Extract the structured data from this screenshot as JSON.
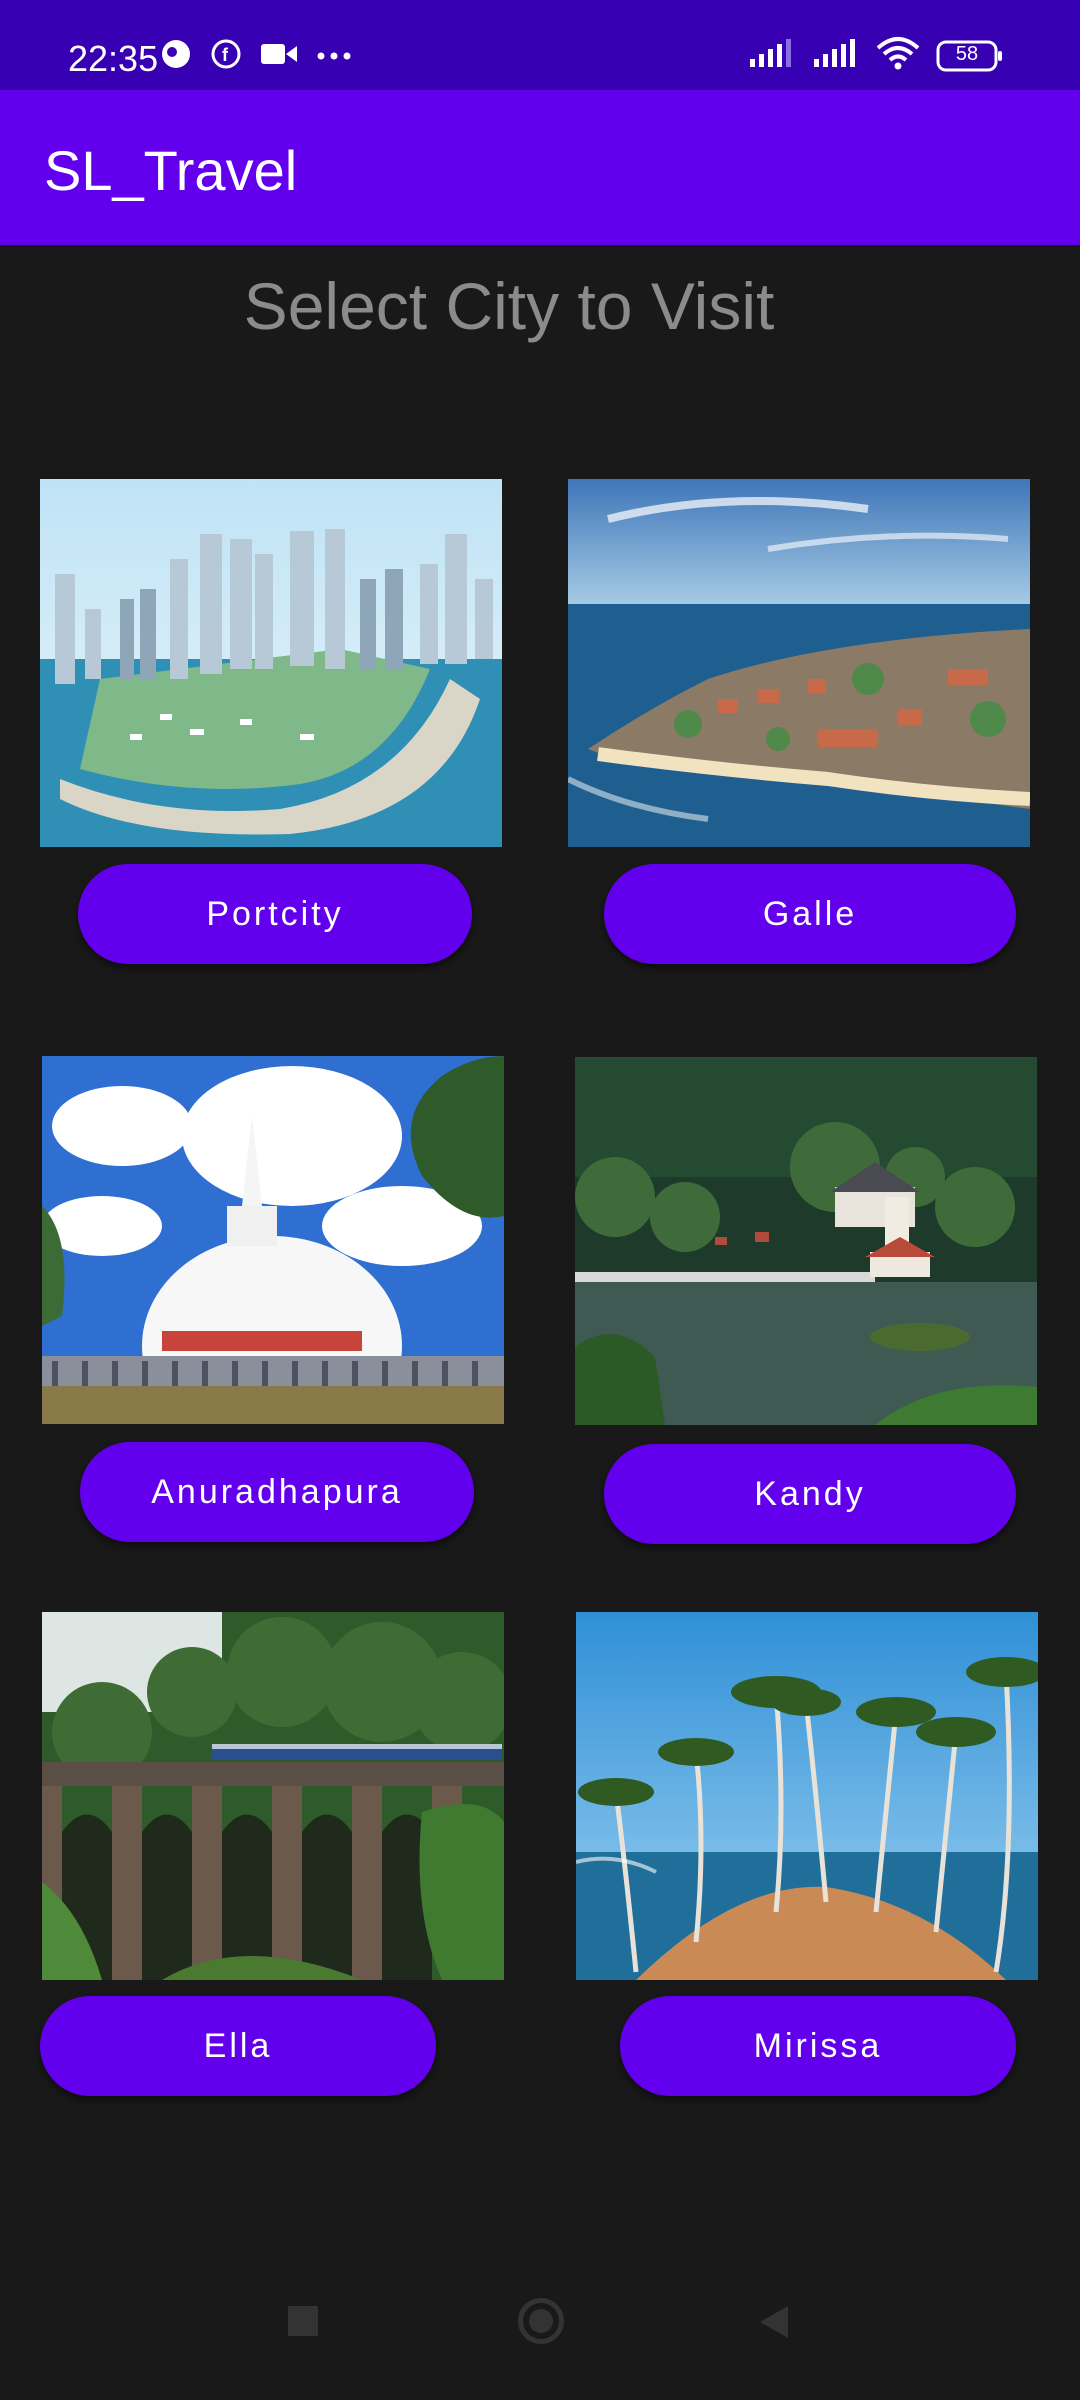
{
  "status": {
    "time": "22:35",
    "battery": "58"
  },
  "app": {
    "title": "SL_Travel"
  },
  "page": {
    "heading": "Select City to Visit"
  },
  "cities": [
    {
      "label": "Portcity"
    },
    {
      "label": "Galle"
    },
    {
      "label": "Anuradhapura"
    },
    {
      "label": "Kandy"
    },
    {
      "label": "Ella"
    },
    {
      "label": "Mirissa"
    }
  ],
  "colors": {
    "primary": "#6200ee",
    "primary_dark": "#3700b3",
    "background": "#191919"
  }
}
